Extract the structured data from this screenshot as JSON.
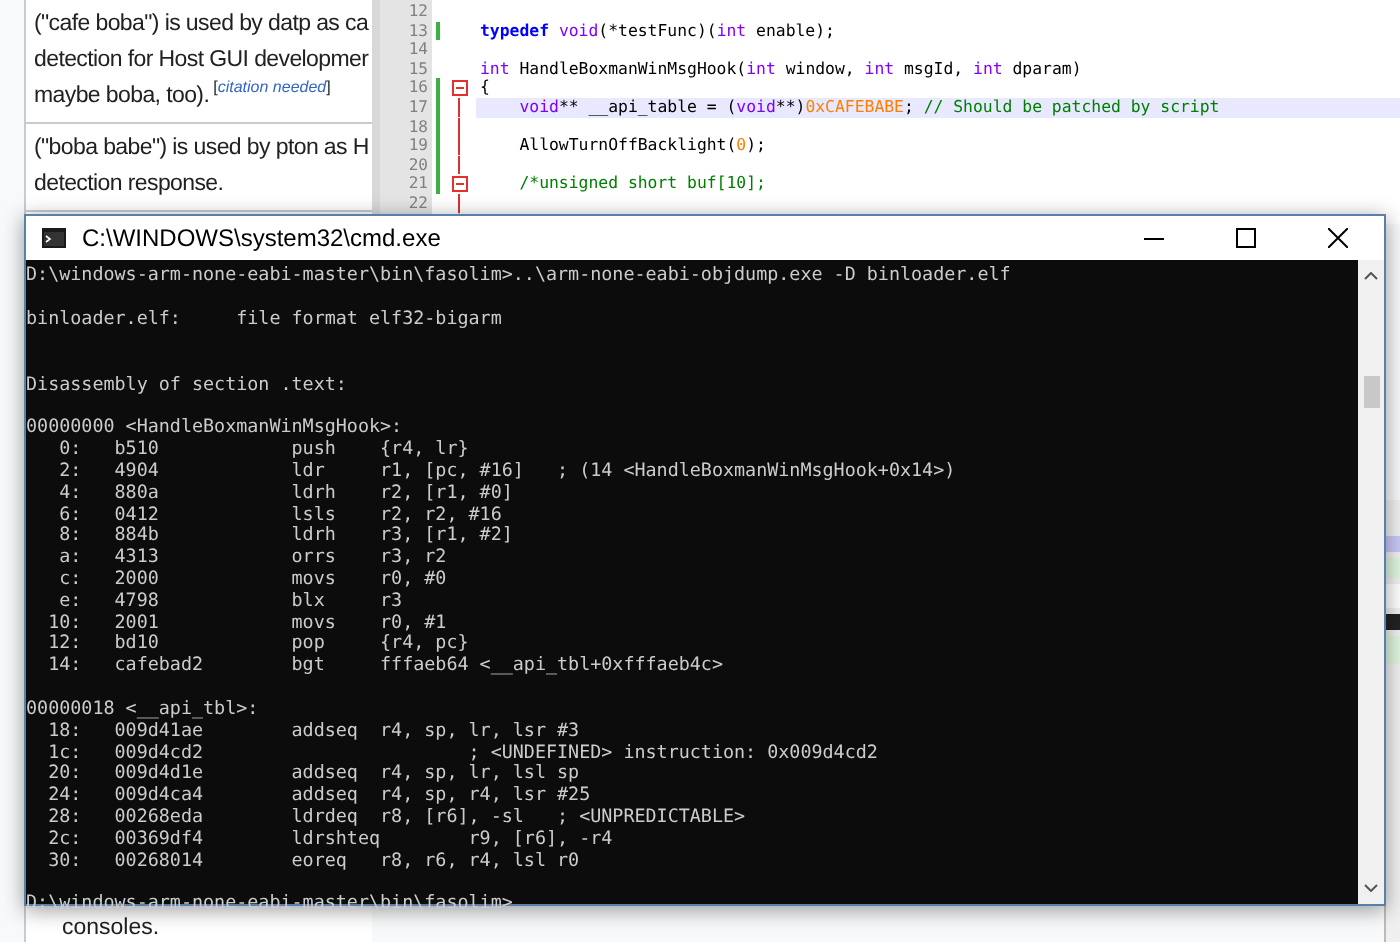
{
  "wiki": {
    "rows": [
      {
        "lines": [
          "(\"cafe boba\") is used by datp as ca",
          "detection for Host GUI developmer",
          "maybe boba, too)."
        ],
        "citation": {
          "open": "[",
          "link": "citation needed",
          "close": "]"
        }
      },
      {
        "lines": [
          "(\"boba babe\") is used by pton as H",
          "detection response."
        ]
      }
    ],
    "footer": "consoles."
  },
  "editor": {
    "lines": [
      {
        "number": "12",
        "highlighted": false,
        "changed": false,
        "fold_start": false,
        "in_fold": false
      },
      {
        "number": "13",
        "tokens": [
          {
            "kind": "keyword",
            "text": "typedef "
          },
          {
            "kind": "type",
            "text": "void"
          },
          {
            "kind": "plain",
            "text": "(*testFunc)("
          },
          {
            "kind": "type",
            "text": "int"
          },
          {
            "kind": "plain",
            "text": " enable);"
          }
        ],
        "highlighted": false,
        "changed": true,
        "fold_start": false,
        "in_fold": false
      },
      {
        "number": "14",
        "highlighted": false,
        "changed": false,
        "fold_start": false,
        "in_fold": false
      },
      {
        "number": "15",
        "tokens": [
          {
            "kind": "type",
            "text": "int"
          },
          {
            "kind": "plain",
            "text": " HandleBoxmanWinMsgHook("
          },
          {
            "kind": "type",
            "text": "int"
          },
          {
            "kind": "plain",
            "text": " window, "
          },
          {
            "kind": "type",
            "text": "int"
          },
          {
            "kind": "plain",
            "text": " msgId, "
          },
          {
            "kind": "type",
            "text": "int"
          },
          {
            "kind": "plain",
            "text": " dparam)"
          }
        ],
        "highlighted": false,
        "changed": false,
        "fold_start": false,
        "in_fold": false
      },
      {
        "number": "16",
        "tokens": [
          {
            "kind": "plain",
            "text": "{"
          }
        ],
        "highlighted": false,
        "changed": true,
        "fold_start": true,
        "in_fold": false
      },
      {
        "number": "17",
        "tokens": [
          {
            "kind": "type",
            "text": "    void"
          },
          {
            "kind": "plain",
            "text": "** __api_table = ("
          },
          {
            "kind": "type",
            "text": "void"
          },
          {
            "kind": "plain",
            "text": "**)"
          },
          {
            "kind": "number",
            "text": "0xCAFEBABE"
          },
          {
            "kind": "plain",
            "text": "; "
          },
          {
            "kind": "comment",
            "text": "// Should be patched by script"
          }
        ],
        "highlighted": true,
        "changed": true,
        "fold_start": false,
        "in_fold": true
      },
      {
        "number": "18",
        "highlighted": false,
        "changed": true,
        "fold_start": false,
        "in_fold": true
      },
      {
        "number": "19",
        "tokens": [
          {
            "kind": "plain",
            "text": "    AllowTurnOffBacklight("
          },
          {
            "kind": "number",
            "text": "0"
          },
          {
            "kind": "plain",
            "text": ");"
          }
        ],
        "highlighted": false,
        "changed": true,
        "fold_start": false,
        "in_fold": true
      },
      {
        "number": "20",
        "highlighted": false,
        "changed": true,
        "fold_start": false,
        "in_fold": true
      },
      {
        "number": "21",
        "tokens": [
          {
            "kind": "comment",
            "text": "    /*unsigned short buf[10];"
          }
        ],
        "highlighted": false,
        "changed": true,
        "fold_start": true,
        "in_fold": false
      },
      {
        "number": "22",
        "highlighted": false,
        "changed": false,
        "fold_start": false,
        "in_fold": true
      }
    ]
  },
  "console": {
    "title": "C:\\WINDOWS\\system32\\cmd.exe",
    "lines": [
      {
        "kind": "command",
        "text": "D:\\windows-arm-none-eabi-master\\bin\\fasolim>..\\arm-none-eabi-objdump.exe -D binloader.elf"
      },
      {
        "kind": "info",
        "text": "binloader.elf:     file format elf32-bigarm"
      },
      {
        "kind": "section",
        "text": "Disassembly of section .text:"
      },
      {
        "kind": "symbol",
        "text": "00000000 <HandleBoxmanWinMsgHook>:"
      },
      {
        "kind": "instruction",
        "text": "   0:   b510            push    {r4, lr}"
      },
      {
        "kind": "instruction",
        "text": "   2:   4904            ldr     r1, [pc, #16]   ; (14 <HandleBoxmanWinMsgHook+0x14>)"
      },
      {
        "kind": "instruction",
        "text": "   4:   880a            ldrh    r2, [r1, #0]"
      },
      {
        "kind": "instruction",
        "text": "   6:   0412            lsls    r2, r2, #16"
      },
      {
        "kind": "instruction",
        "text": "   8:   884b            ldrh    r3, [r1, #2]"
      },
      {
        "kind": "instruction",
        "text": "   a:   4313            orrs    r3, r2"
      },
      {
        "kind": "instruction",
        "text": "   c:   2000            movs    r0, #0"
      },
      {
        "kind": "instruction",
        "text": "   e:   4798            blx     r3"
      },
      {
        "kind": "instruction",
        "text": "  10:   2001            movs    r0, #1"
      },
      {
        "kind": "instruction",
        "text": "  12:   bd10            pop     {r4, pc}"
      },
      {
        "kind": "instruction",
        "text": "  14:   cafebad2        bgt     fffaeb64 <__api_tbl+0xfffaeb4c>"
      },
      {
        "kind": "symbol",
        "text": "00000018 <__api_tbl>:"
      },
      {
        "kind": "instruction",
        "text": "  18:   009d41ae        addseq  r4, sp, lr, lsr #3"
      },
      {
        "kind": "instruction",
        "text": "  1c:   009d4cd2                        ; <UNDEFINED> instruction: 0x009d4cd2"
      },
      {
        "kind": "instruction",
        "text": "  20:   009d4d1e        addseq  r4, sp, lr, lsl sp"
      },
      {
        "kind": "instruction",
        "text": "  24:   009d4ca4        addseq  r4, sp, r4, lsr #25"
      },
      {
        "kind": "instruction",
        "text": "  28:   00268eda        ldrdeq  r8, [r6], -sl   ; <UNPREDICTABLE>"
      },
      {
        "kind": "instruction",
        "text": "  2c:   00369df4        ldrshteq        r9, [r6], -r4"
      },
      {
        "kind": "instruction",
        "text": "  30:   00268014        eoreq   r8, r6, r4, lsl r0"
      },
      {
        "kind": "prompt",
        "text": "D:\\windows-arm-none-eabi-master\\bin\\fasolim>"
      }
    ]
  }
}
